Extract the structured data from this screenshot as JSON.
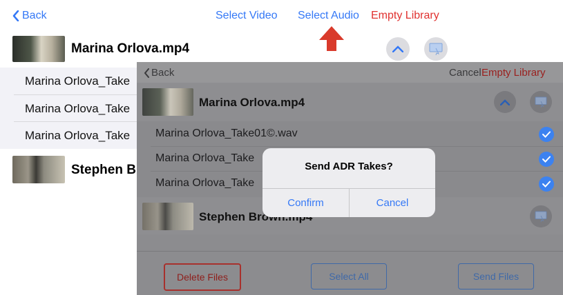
{
  "back_screen": {
    "nav": {
      "back_label": "Back",
      "select_video": "Select Video",
      "select_audio": "Select Audio",
      "empty_library": "Empty Library"
    },
    "video1_title": "Marina Orlova.mp4",
    "takes": [
      "Marina Orlova_Take",
      "Marina Orlova_Take",
      "Marina Orlova_Take"
    ],
    "video2_title": "Stephen B"
  },
  "front_screen": {
    "nav": {
      "back_label": "Back",
      "cancel": "Cancel",
      "empty_library": "Empty Library"
    },
    "video1_title": "Marina Orlova.mp4",
    "takes": [
      "Marina Orlova_Take01©.wav",
      "Marina Orlova_Take",
      "Marina Orlova_Take"
    ],
    "video2_title": "Stephen Brown.mp4",
    "buttons": {
      "delete": "Delete Files",
      "select_all": "Select All",
      "send": "Send Files"
    }
  },
  "dialog": {
    "title": "Send ADR Takes?",
    "confirm": "Confirm",
    "cancel": "Cancel"
  },
  "colors": {
    "accent": "#3478f6",
    "destructive": "#e0312f",
    "annotation_arrow": "#d93a2b"
  }
}
